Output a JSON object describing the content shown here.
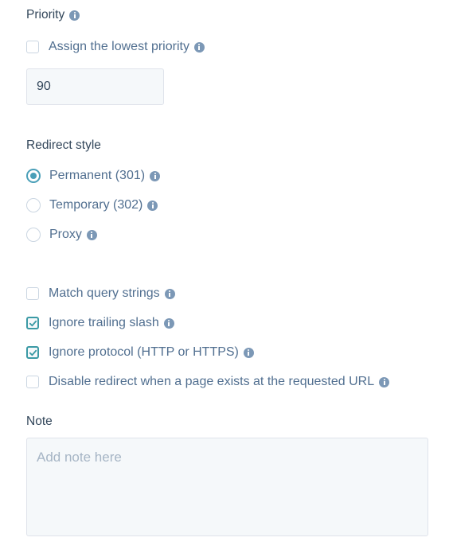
{
  "priority": {
    "label": "Priority",
    "info_icon": "info-icon",
    "lowest_checkbox": {
      "label": "Assign the lowest priority",
      "checked": false
    },
    "value": "90"
  },
  "redirect_style": {
    "label": "Redirect style",
    "options": [
      {
        "label": "Permanent (301)",
        "selected": true
      },
      {
        "label": "Temporary (302)",
        "selected": false
      },
      {
        "label": "Proxy",
        "selected": false
      }
    ]
  },
  "options": [
    {
      "label": "Match query strings",
      "checked": false
    },
    {
      "label": "Ignore trailing slash",
      "checked": true
    },
    {
      "label": "Ignore protocol (HTTP or HTTPS)",
      "checked": true
    },
    {
      "label": "Disable redirect when a page exists at the requested URL",
      "checked": false
    }
  ],
  "note": {
    "label": "Note",
    "placeholder": "Add note here",
    "value": ""
  },
  "colors": {
    "accent": "#4a9fb8",
    "checkbox_checked_border": "#3b9aa5",
    "text_label": "#33475b",
    "text_option": "#516f90",
    "info_icon": "#7c98b6",
    "field_bg": "#f5f8fa",
    "field_border": "#dfe3eb"
  }
}
